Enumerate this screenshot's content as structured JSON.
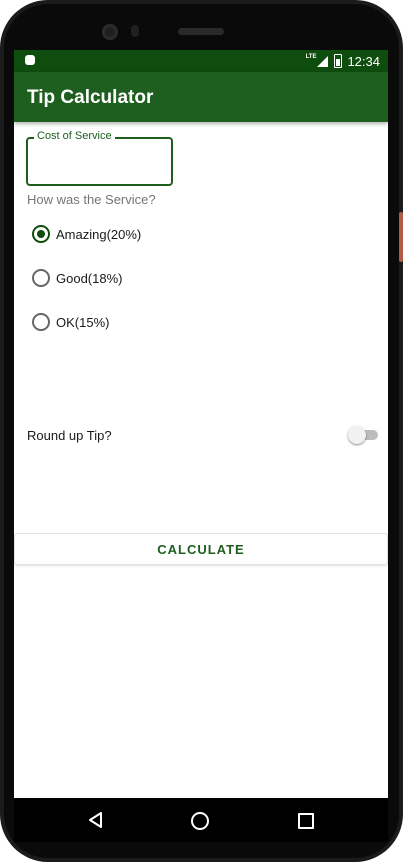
{
  "status_bar": {
    "time": "12:34",
    "network": "LTE"
  },
  "app_bar": {
    "title": "Tip Calculator"
  },
  "cost_field": {
    "label": "Cost of Service",
    "value": ""
  },
  "service_question": "How was the Service?",
  "radio_options": [
    {
      "label": "Amazing(20%)",
      "checked": true
    },
    {
      "label": "Good(18%)",
      "checked": false
    },
    {
      "label": "OK(15%)",
      "checked": false
    }
  ],
  "round_up": {
    "label": "Round up Tip?",
    "enabled": false
  },
  "calculate_button": {
    "label": "CALCULATE"
  },
  "nav_bar": {
    "icons": [
      "back-icon",
      "home-icon",
      "recents-icon"
    ]
  },
  "colors": {
    "primary": "#1e5e1e",
    "primary_dark": "#0f4d0f"
  }
}
